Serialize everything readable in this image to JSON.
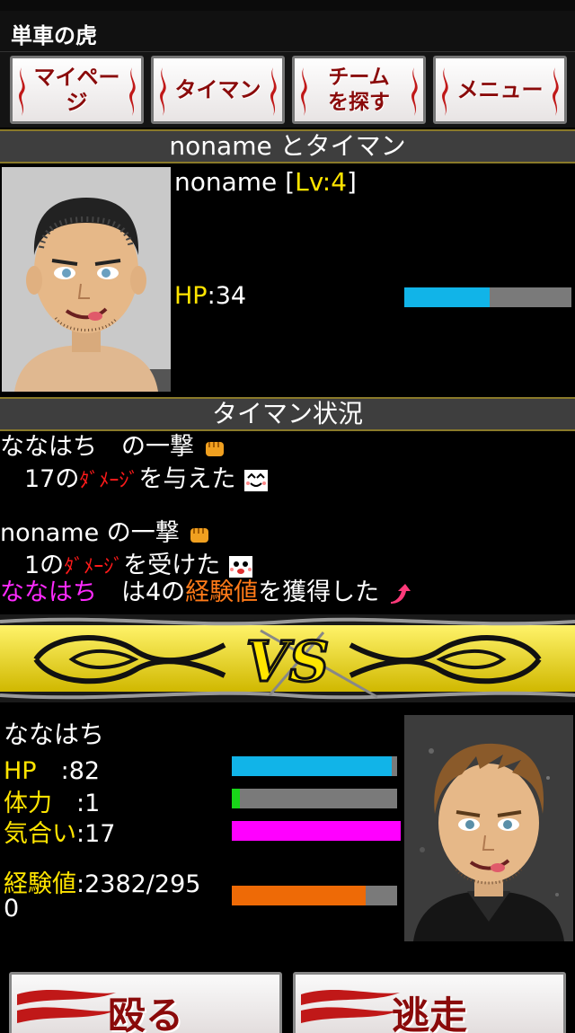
{
  "app": {
    "title": "単車の虎"
  },
  "nav": [
    {
      "label": "マイページ"
    },
    {
      "label": "タイマン"
    },
    {
      "label": "チームを探す"
    },
    {
      "label": "メニュー"
    }
  ],
  "enemy": {
    "header": "noname とタイマン",
    "name": "noname",
    "level_open": " [",
    "level": "Lv:4",
    "level_close": "]",
    "hp_label": "HP",
    "hp_value": ":34",
    "hp_fraction": 0.51
  },
  "battle": {
    "header": "タイマン状況",
    "log": {
      "l1_actor": "ななはち",
      "l1_rest": "　の一撃",
      "l2_pre": "　17の",
      "l2_red": "ﾀﾞﾒｰｼﾞ",
      "l2_post": "を与えた",
      "l3_actor": "noname",
      "l3_rest": " の一撃",
      "l4_pre": "　1の",
      "l4_red": "ﾀﾞﾒｰｼﾞ",
      "l4_post": "を受けた",
      "l5_name": "ななはち",
      "l5_mid": "　は4の",
      "l5_exp": "経験値",
      "l5_post": "を獲得した"
    },
    "vs_text": "VS"
  },
  "player": {
    "name": "ななはち",
    "hp_label": "HP",
    "hp_value": "　:82",
    "hp_fraction": 0.97,
    "stamina_label": "体力",
    "stamina_value": "　:1",
    "stamina_fraction": 0.05,
    "spirit_label": "気合い",
    "spirit_value": ":17",
    "spirit_fraction": 1.0,
    "exp_label": "経験値",
    "exp_value_line1": ":2382/295",
    "exp_value_line2": "0",
    "exp_fraction": 0.81
  },
  "actions": {
    "attack": "殴る",
    "flee": "逃走"
  },
  "colors": {
    "hp_bar": "#11b4e8",
    "stamina_bar": "#19d619",
    "spirit_bar": "#ff00ff",
    "exp_bar": "#ee6a06",
    "label_yellow": "#ffe400",
    "accent_red": "#8a0a0a"
  }
}
